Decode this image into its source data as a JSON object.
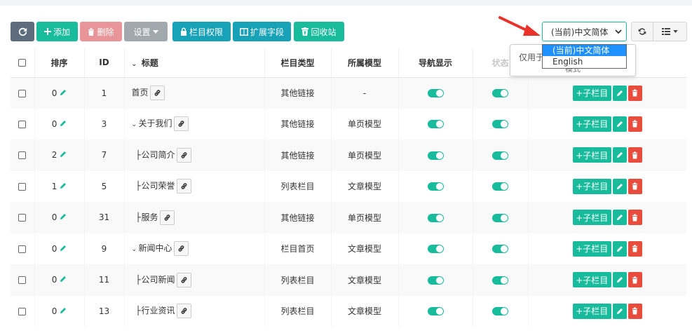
{
  "toolbar": {
    "add": "添加",
    "delete": "删除",
    "settings": "设置",
    "permissions": "栏目权限",
    "extend_fields": "扩展字段",
    "recycle": "回收站"
  },
  "language": {
    "selected": "(当前)中文简体",
    "options": [
      "(当前)中文简体",
      "English"
    ]
  },
  "popover": {
    "text": "仅用于",
    "sub": "模式"
  },
  "columns": [
    "排序",
    "ID",
    "标题",
    "栏目类型",
    "所属模型",
    "导航显示",
    "状态",
    ""
  ],
  "row_actions": {
    "add_sub": "+子栏目"
  },
  "rows": [
    {
      "sort": "0",
      "id": "1",
      "title": "首页",
      "prefix": "",
      "type": "其他链接",
      "model": "-"
    },
    {
      "sort": "0",
      "id": "3",
      "title": "关于我们",
      "prefix": "chev",
      "type": "其他链接",
      "model": "单页模型"
    },
    {
      "sort": "2",
      "id": "7",
      "title": "公司简介",
      "prefix": "branch",
      "type": "其他链接",
      "model": "单页模型"
    },
    {
      "sort": "1",
      "id": "5",
      "title": "公司荣誉",
      "prefix": "branch",
      "type": "列表栏目",
      "model": "文章模型"
    },
    {
      "sort": "0",
      "id": "31",
      "title": "服务",
      "prefix": "branch",
      "type": "其他链接",
      "model": "单页模型"
    },
    {
      "sort": "0",
      "id": "9",
      "title": "新闻中心",
      "prefix": "chev",
      "type": "栏目首页",
      "model": "文章模型"
    },
    {
      "sort": "0",
      "id": "11",
      "title": "公司新闻",
      "prefix": "branch",
      "type": "列表栏目",
      "model": "文章模型"
    },
    {
      "sort": "0",
      "id": "13",
      "title": "行业资讯",
      "prefix": "branch",
      "type": "列表栏目",
      "model": "文章模型"
    }
  ],
  "colors": {
    "primary": "#18bc9c",
    "danger": "#e74c3c",
    "info": "#18a2b8",
    "dark": "#6c757d"
  }
}
